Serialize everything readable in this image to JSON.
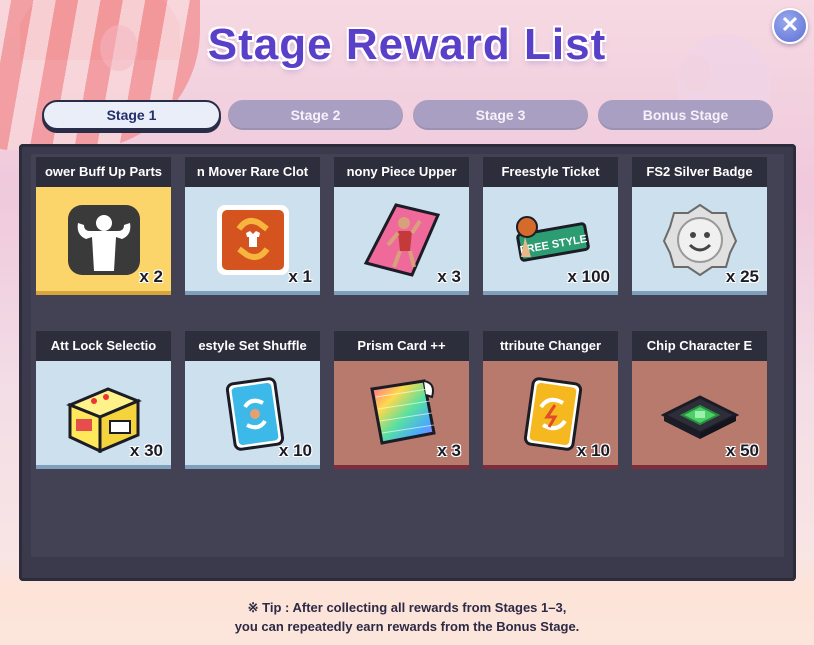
{
  "header": {
    "title": "Stage Reward List",
    "close_label": "✕"
  },
  "tabs": [
    {
      "label": "Stage 1",
      "active": true
    },
    {
      "label": "Stage 2",
      "active": false
    },
    {
      "label": "Stage 3",
      "active": false
    },
    {
      "label": "Bonus Stage",
      "active": false
    }
  ],
  "rewards": [
    {
      "name": "ower Buff Up Parts",
      "qty": "x 2",
      "bg": "gold",
      "icon": "muscle-silhouette-icon"
    },
    {
      "name": "n Mover   Rare Clot",
      "qty": "x 1",
      "bg": "blue",
      "icon": "outfit-change-icon"
    },
    {
      "name": "nony Piece   Upper",
      "qty": "x 3",
      "bg": "blue",
      "icon": "dancer-piece-icon"
    },
    {
      "name": "Freestyle Ticket",
      "qty": "x 100",
      "bg": "blue",
      "icon": "freestyle-ticket-icon"
    },
    {
      "name": "FS2 Silver Badge",
      "qty": "x 25",
      "bg": "blue",
      "icon": "silver-badge-icon"
    },
    {
      "name": "Att Lock Selectio",
      "qty": "x 30",
      "bg": "blue",
      "icon": "arcade-box-icon"
    },
    {
      "name": "estyle Set Shuffle",
      "qty": "x 10",
      "bg": "blue",
      "icon": "shuffle-card-icon"
    },
    {
      "name": "Prism Card ++",
      "qty": "x 3",
      "bg": "red",
      "icon": "prism-card-icon"
    },
    {
      "name": "ttribute Changer",
      "qty": "x 10",
      "bg": "red",
      "icon": "attribute-changer-icon"
    },
    {
      "name": "Chip   Character E",
      "qty": "x 50",
      "bg": "red",
      "icon": "chip-icon"
    }
  ],
  "tip": {
    "line1": "※ Tip : After collecting all rewards from Stages 1–3,",
    "line2": "you can repeatedly earn rewards from the Bonus Stage."
  },
  "colors": {
    "title": "#5a3fc8",
    "panel": "#3a3a4c",
    "card_gold": "#fcd56a",
    "card_blue": "#cde0ee",
    "card_red": "#b87a6d"
  }
}
